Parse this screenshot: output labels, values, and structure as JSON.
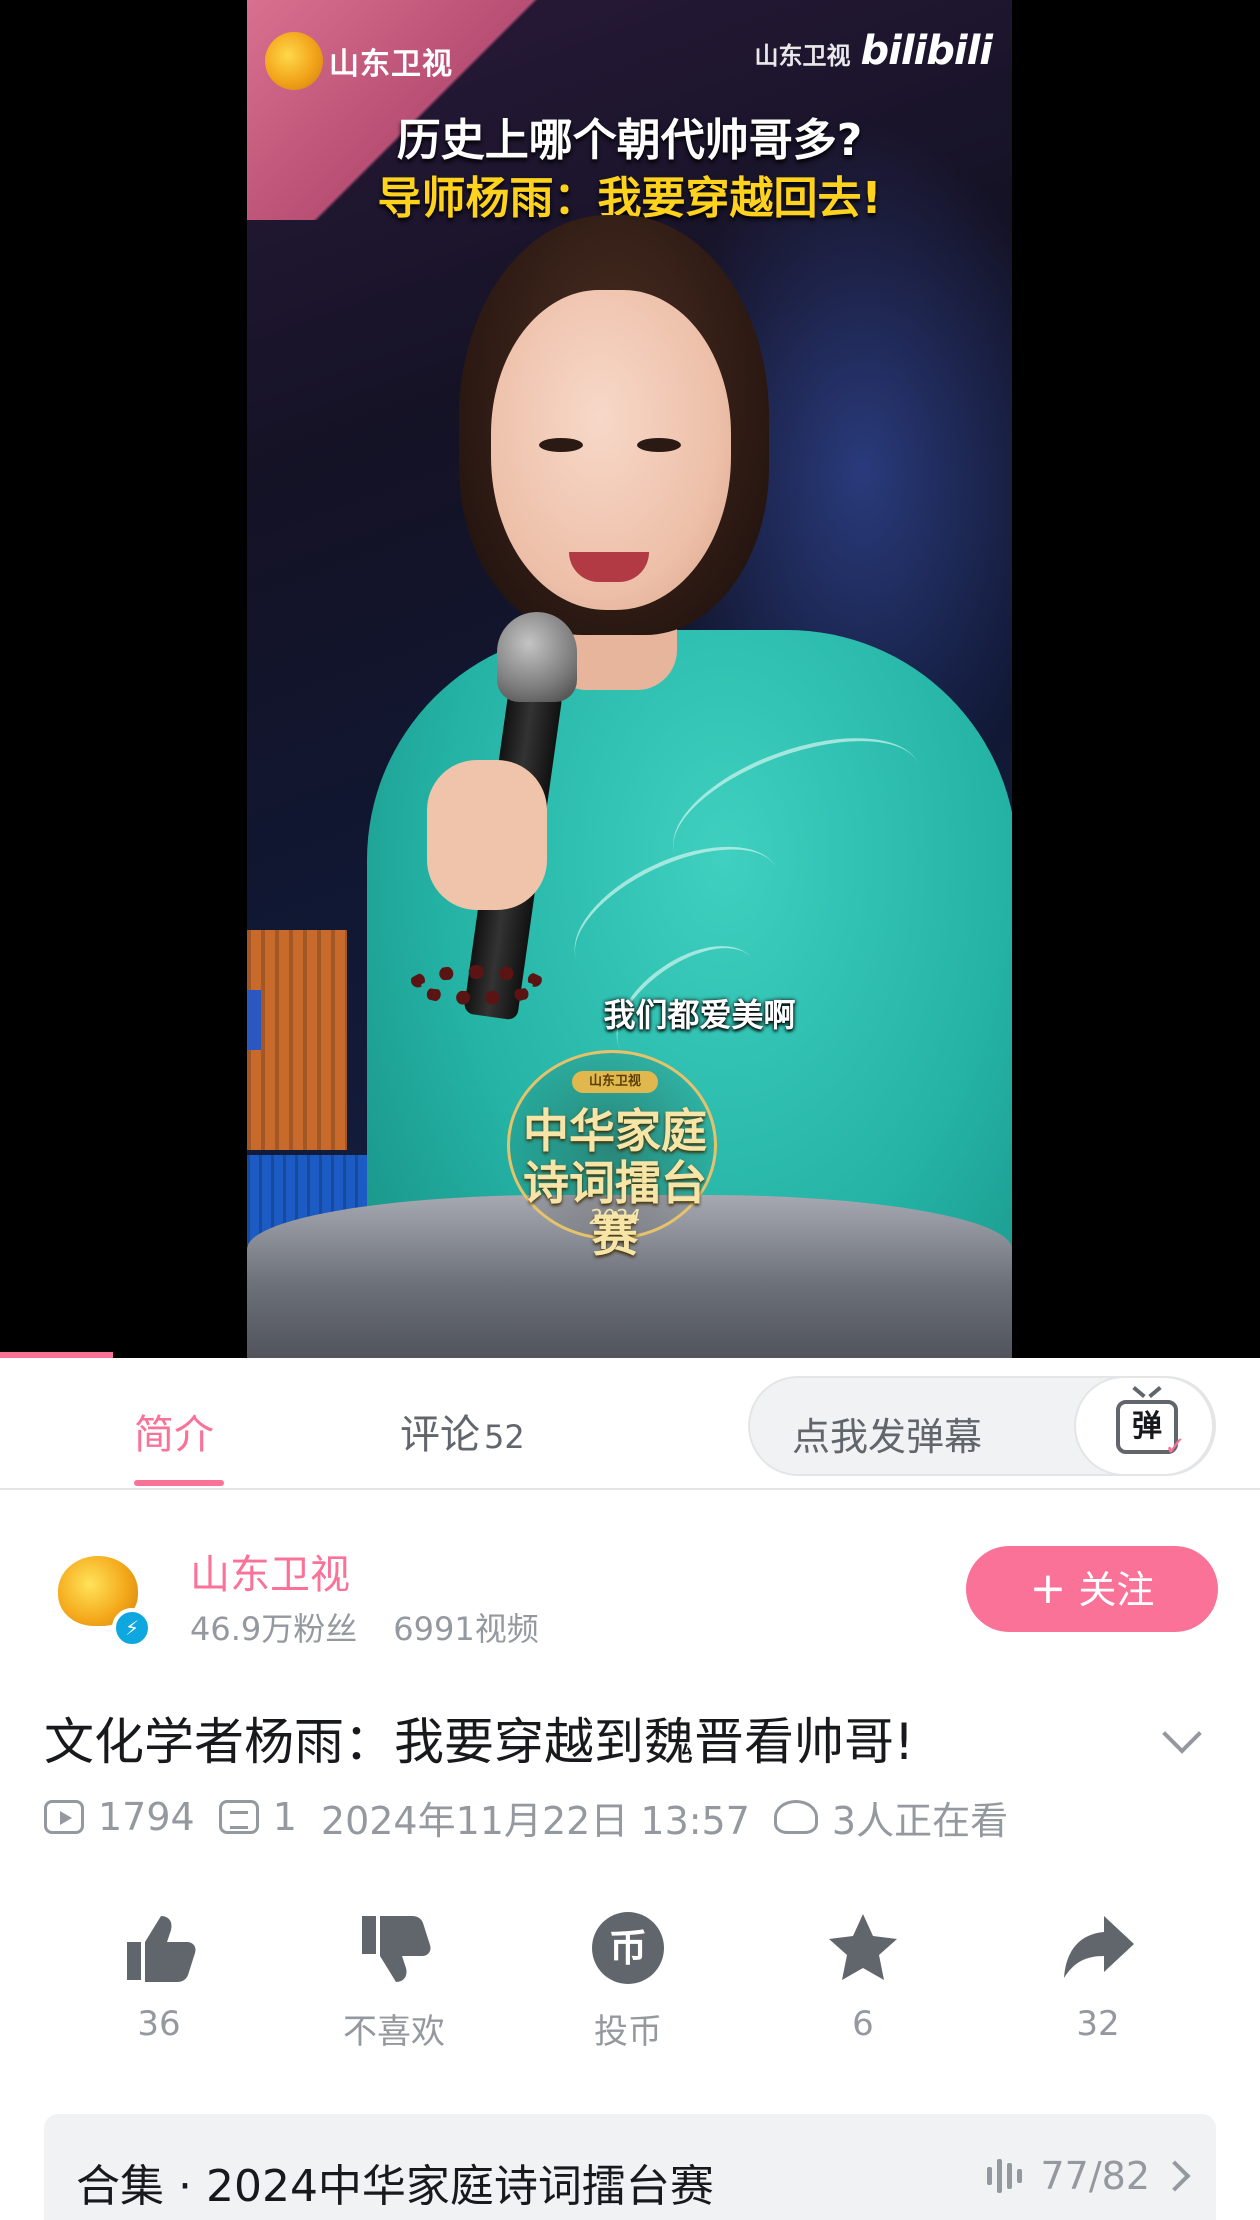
{
  "video": {
    "channel_logo_text": "山东卫视",
    "watermark_channel": "山东卫视",
    "watermark_brand": "bilibili",
    "headline_line1": "历史上哪个朝代帅哥多?",
    "headline_line2": "导师杨雨：我要穿越回去!",
    "subtitle": "我们都爱美啊",
    "badge_chip": "山东卫视",
    "badge_title": "中华家庭诗词擂台赛",
    "badge_year": "2024",
    "progress": 0.09
  },
  "tabs": {
    "intro": "简介",
    "comments": "评论",
    "comments_count": "52",
    "danmaku_placeholder": "点我发弹幕",
    "danmaku_icon_glyph": "弹"
  },
  "uploader": {
    "name": "山东卫视",
    "followers": "46.9万粉丝",
    "videos": "6991视频",
    "follow_label": "关注",
    "follow_plus": "+"
  },
  "video_info": {
    "title": "文化学者杨雨：我要穿越到魏晋看帅哥!",
    "plays": "1794",
    "danmaku_count": "1",
    "date": "2024年11月22日 13:57",
    "watching": "3人正在看"
  },
  "actions": {
    "like_count": "36",
    "dislike_label": "不喜欢",
    "coin_label": "投币",
    "coin_glyph": "币",
    "favorite_count": "6",
    "share_count": "32"
  },
  "collection": {
    "title": "合集 · 2024中华家庭诗词擂台赛",
    "progress": "77/82"
  },
  "colors": {
    "accent": "#fb7299",
    "text_primary": "#18191c",
    "text_secondary": "#9499a0",
    "icon": "#61666d"
  }
}
